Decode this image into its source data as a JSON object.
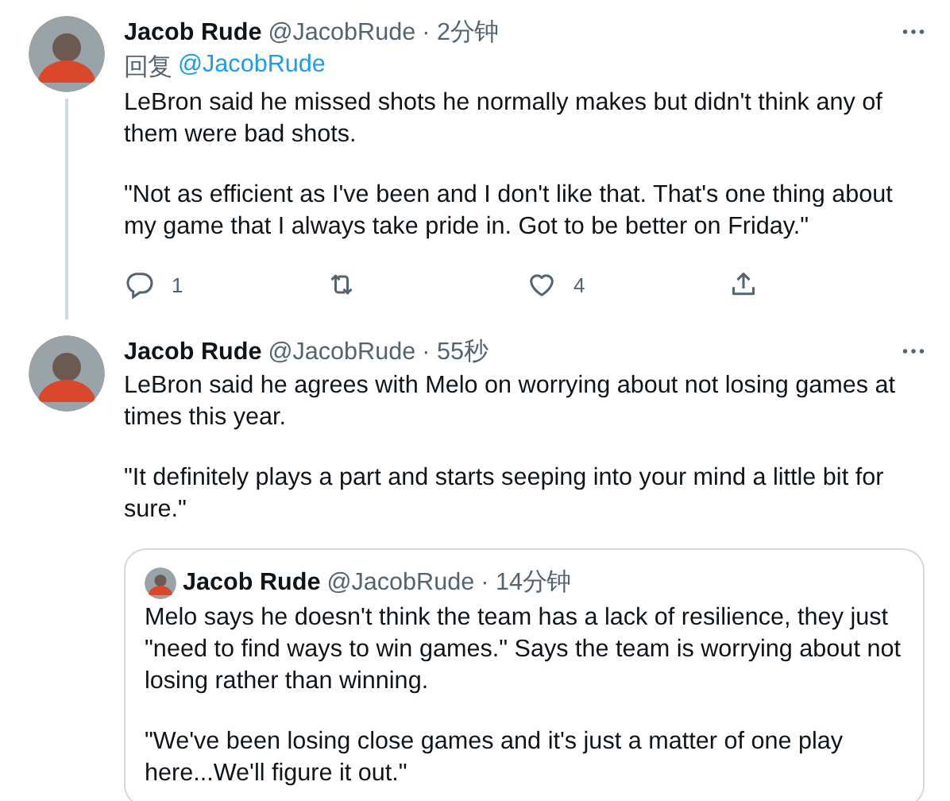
{
  "tweets": [
    {
      "name": "Jacob Rude",
      "handle": "@JacobRude",
      "time": "· 2分钟",
      "reply_prefix": "回复",
      "reply_to": "@JacobRude",
      "thread_line": true,
      "paragraphs": [
        "LeBron said he missed shots he normally makes but didn't think any of them were bad shots.",
        "\"Not as efficient as I've been and I don't like that. That's one thing about my game that I always take pride in. Got to be better on Friday.\""
      ],
      "actions": [
        {
          "kind": "reply",
          "count": "1"
        },
        {
          "kind": "retweet"
        },
        {
          "kind": "like",
          "count": "4"
        },
        {
          "kind": "share"
        }
      ]
    },
    {
      "name": "Jacob Rude",
      "handle": "@JacobRude",
      "time": "· 55秒",
      "thread_line": false,
      "paragraphs": [
        "LeBron said he agrees with Melo on worrying about not losing games at times this year.",
        "\"It definitely plays a part and starts seeping into your mind a little bit for sure.\""
      ],
      "quote": {
        "name": "Jacob Rude",
        "handle": "@JacobRude",
        "time": "· 14分钟",
        "paragraphs": [
          "Melo says he doesn't think the team has a lack of resilience, they just \"need to find ways to win games.\" Says the team is worrying about not losing rather than winning.",
          "\"We've been losing close games and it's just a matter of one play here...We'll figure it out.\""
        ]
      }
    }
  ]
}
